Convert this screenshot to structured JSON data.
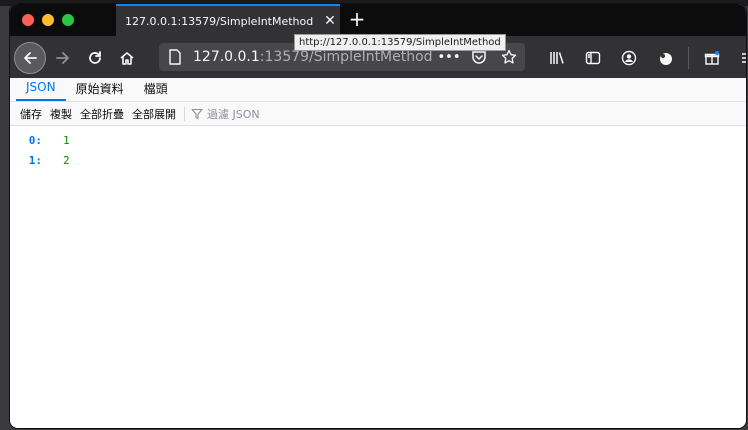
{
  "browser": {
    "tab_title": "127.0.0.1:13579/SimpleIntMethod",
    "tab_close_glyph": "✕",
    "new_tab_glyph": "+",
    "url_host": "127.0.0.1",
    "url_rest": ":13579/SimpleIntMethod",
    "tooltip": "http://127.0.0.1:13579/SimpleIntMethod",
    "url_more_glyph": "•••"
  },
  "viewer": {
    "tabs": [
      "JSON",
      "原始資料",
      "檔頭"
    ],
    "active_tab": 0,
    "toolbar": {
      "save_label": "儲存",
      "copy_label": "複製",
      "collapse_all_label": "全部折疊",
      "expand_all_label": "全部展開",
      "filter_placeholder": "過濾 JSON"
    },
    "rows": [
      {
        "key": "0:",
        "value": "1"
      },
      {
        "key": "1:",
        "value": "2"
      }
    ]
  },
  "colors": {
    "accent": "#0074e8",
    "value_number": "#058b00",
    "chrome_dark": "#323234"
  }
}
